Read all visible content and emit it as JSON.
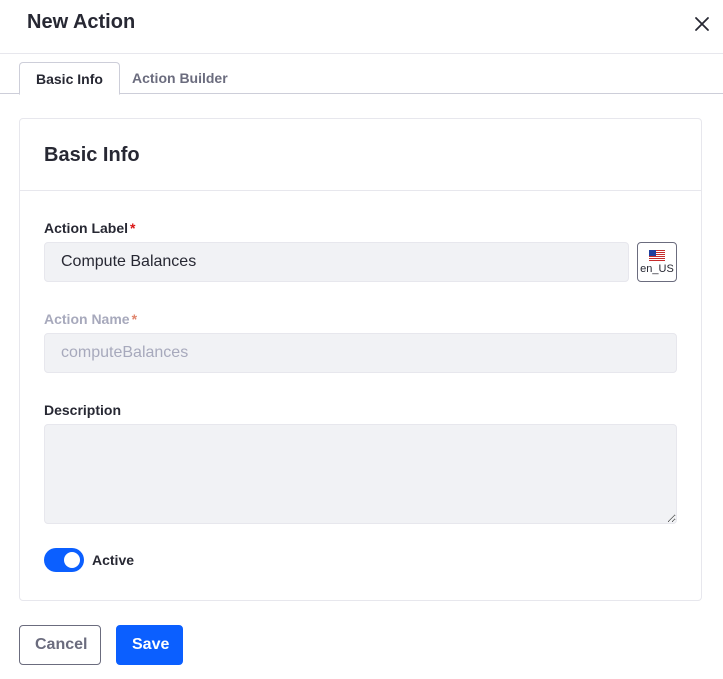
{
  "modal": {
    "title": "New Action"
  },
  "tabs": [
    {
      "label": "Basic Info",
      "active": true
    },
    {
      "label": "Action Builder",
      "active": false
    }
  ],
  "card": {
    "title": "Basic Info"
  },
  "fields": {
    "action_label": {
      "label": "Action Label",
      "required_mark": "*",
      "value": "Compute Balances"
    },
    "locale": {
      "code": "en_US",
      "icon": "us-flag-icon"
    },
    "action_name": {
      "label": "Action Name",
      "required_mark": "*",
      "value": "computeBalances",
      "disabled": true
    },
    "description": {
      "label": "Description",
      "value": ""
    }
  },
  "active_toggle": {
    "label": "Active",
    "checked": true
  },
  "footer": {
    "cancel_label": "Cancel",
    "save_label": "Save"
  },
  "colors": {
    "primary": "#0b5fff",
    "required": "#da1414",
    "text": "#272833",
    "muted": "#6b6c7e"
  }
}
